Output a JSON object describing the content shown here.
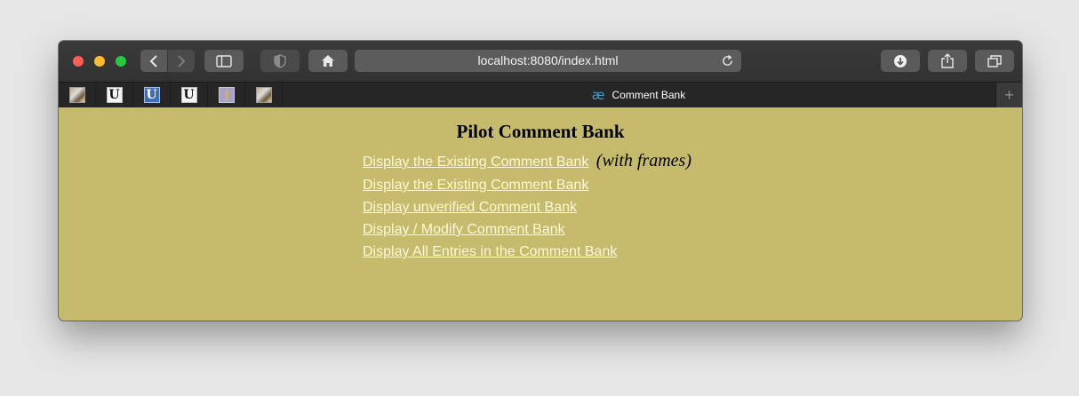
{
  "browser": {
    "address_text": "localhost:8080/index.html",
    "tab_title": "Comment Bank",
    "tab_icon_glyph": "æ",
    "new_tab_glyph": "+",
    "favorites": [
      {
        "icon": "photo-favicon",
        "glyph": ""
      },
      {
        "icon": "u-logo-favicon",
        "glyph": "U"
      },
      {
        "icon": "u-logo-blue-favicon",
        "glyph": "U"
      },
      {
        "icon": "u-logo-favicon",
        "glyph": "U"
      },
      {
        "icon": "purple-favicon",
        "glyph": ""
      },
      {
        "icon": "photo-favicon",
        "glyph": ""
      }
    ],
    "colors": {
      "traffic_red": "#fe5f57",
      "traffic_yellow": "#febc2e",
      "traffic_green": "#28c840"
    }
  },
  "page": {
    "title": "Pilot Comment Bank",
    "background": "#c6bb6d",
    "link_color": "#fff7d6",
    "links": [
      {
        "label": "Display the Existing Comment Bank",
        "note": "(with frames)"
      },
      {
        "label": "Display the Existing Comment Bank"
      },
      {
        "label": "Display unverified Comment Bank"
      },
      {
        "label": "Display / Modify Comment Bank"
      },
      {
        "label": "Display All Entries in the Comment Bank"
      }
    ]
  }
}
